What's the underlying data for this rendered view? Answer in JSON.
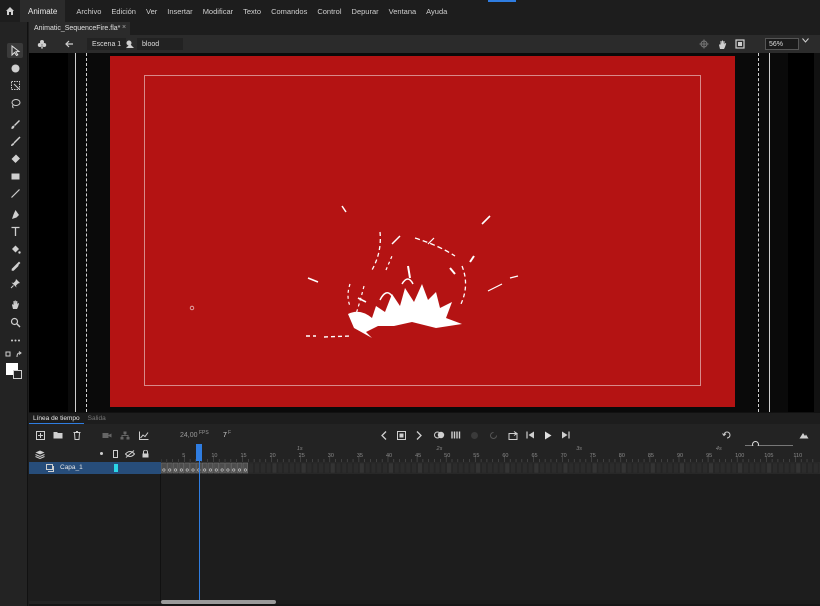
{
  "menubar": {
    "app_tab": "Animate",
    "items": [
      "Archivo",
      "Edición",
      "Ver",
      "Insertar",
      "Modificar",
      "Texto",
      "Comandos",
      "Control",
      "Depurar",
      "Ventana",
      "Ayuda"
    ]
  },
  "document": {
    "tab_title": "Animatic_SequenceFire.fla*",
    "close_glyph": "×"
  },
  "editbar": {
    "scene": "Escena 1",
    "symbol": "blood",
    "zoom": "56%"
  },
  "colors": {
    "stage": "#b41313",
    "accent": "#2f7de1",
    "layer_color": "#2bd5e8"
  },
  "timeline": {
    "tabs": [
      "Línea de tiempo",
      "Salida"
    ],
    "fps_value": "24,00",
    "fps_unit": "FPS",
    "current_frame": "7",
    "frame_unit": "F",
    "layer_name": "Capa_1",
    "ruler_ticks": [
      "5",
      "10",
      "15",
      "20",
      "25",
      "30",
      "35",
      "40",
      "45",
      "50",
      "55",
      "60",
      "65",
      "70",
      "75",
      "80",
      "85",
      "90",
      "95",
      "100",
      "105",
      "110"
    ],
    "seconds": [
      "1s",
      "2s",
      "3s",
      "4s"
    ],
    "playhead_frame": 7,
    "filled_frames": 15
  }
}
